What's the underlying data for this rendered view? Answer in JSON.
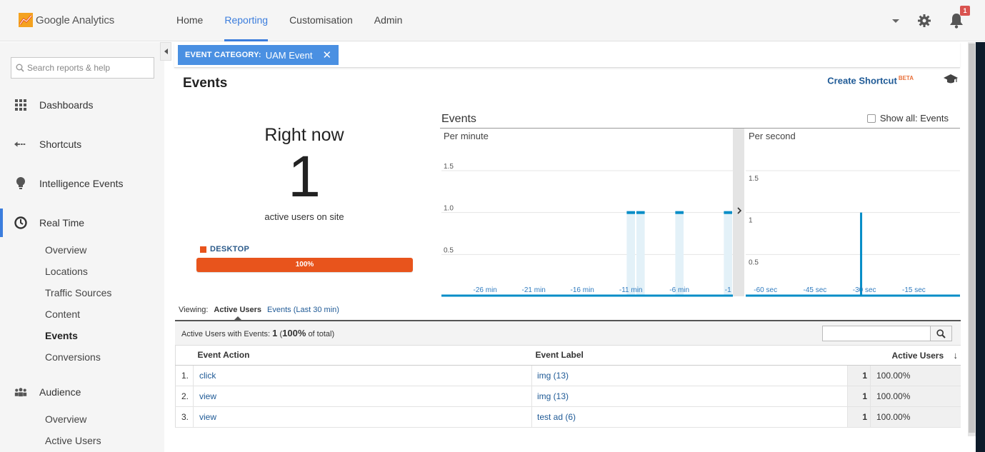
{
  "app": {
    "name": "Google Analytics"
  },
  "nav": {
    "items": [
      {
        "label": "Home",
        "active": false
      },
      {
        "label": "Reporting",
        "active": true
      },
      {
        "label": "Customisation",
        "active": false
      },
      {
        "label": "Admin",
        "active": false
      }
    ],
    "notification_count": "1"
  },
  "sidebar": {
    "search_placeholder": "Search reports & help",
    "sections": [
      {
        "label": "Dashboards",
        "icon": "grid-icon"
      },
      {
        "label": "Shortcuts",
        "icon": "shortcut-arrow-icon"
      },
      {
        "label": "Intelligence Events",
        "icon": "lightbulb-icon"
      },
      {
        "label": "Real Time",
        "icon": "clock-icon",
        "active": true
      },
      {
        "label": "Audience",
        "icon": "people-icon"
      }
    ],
    "realtime_items": [
      "Overview",
      "Locations",
      "Traffic Sources",
      "Content",
      "Events",
      "Conversions"
    ],
    "audience_items": [
      "Overview",
      "Active Users"
    ]
  },
  "filter": {
    "key": "EVENT CATEGORY:",
    "value": "UAM Event"
  },
  "page": {
    "title": "Events",
    "shortcut_label": "Create Shortcut",
    "shortcut_badge": "BETA"
  },
  "rightnow": {
    "title": "Right now",
    "count": "1",
    "subtitle": "active users on site",
    "device_label": "DESKTOP",
    "device_pct": "100%",
    "device_fraction": 1.0
  },
  "chart": {
    "title": "Events",
    "show_all_label": "Show all: Events",
    "show_all_checked": false,
    "accent": "#058dc7"
  },
  "chart_data": [
    {
      "type": "bar",
      "subtitle": "Per minute",
      "y_ticks": [
        "1.5",
        "1.0",
        "0.5"
      ],
      "ylim": [
        0,
        1.5
      ],
      "x_ticks": [
        "-26 min",
        "-21 min",
        "-16 min",
        "-11 min",
        "-6 min",
        "-1"
      ],
      "x_tick_minutes": [
        -26,
        -21,
        -16,
        -11,
        -6,
        -1
      ],
      "x": [
        -30,
        -29,
        -28,
        -27,
        -26,
        -25,
        -24,
        -23,
        -22,
        -21,
        -20,
        -19,
        -18,
        -17,
        -16,
        -15,
        -14,
        -13,
        -12,
        -11,
        -10,
        -9,
        -8,
        -7,
        -6,
        -5,
        -4,
        -3,
        -2,
        -1
      ],
      "values": [
        0,
        0,
        0,
        0,
        0,
        0,
        0,
        0,
        0,
        0,
        0,
        0,
        0,
        0,
        0,
        0,
        0,
        0,
        0,
        1,
        1,
        0,
        0,
        0,
        1,
        0,
        0,
        0,
        0,
        1
      ],
      "last_tick_suffix": "..."
    },
    {
      "type": "bar",
      "subtitle": "Per second",
      "y_ticks": [
        "1.5",
        "1",
        "0.5"
      ],
      "ylim": [
        0,
        1.5
      ],
      "x_ticks": [
        "-60 sec",
        "-45 sec",
        "-30 sec",
        "-15 sec"
      ],
      "x_tick_seconds": [
        -60,
        -45,
        -30,
        -15
      ],
      "xlim": [
        -66,
        -1
      ],
      "spikes": [
        {
          "x": -31,
          "value": 1
        }
      ]
    }
  ],
  "viewing": {
    "label": "Viewing:",
    "current": "Active Users",
    "other": "Events (Last 30 min)"
  },
  "summary": {
    "prefix": "Active Users with Events:",
    "count": "1",
    "pct": "100%",
    "suffix": "of total)",
    "open": "("
  },
  "table": {
    "columns": [
      "Event Action",
      "Event Label",
      "Active Users"
    ],
    "rows": [
      {
        "idx": "1.",
        "action": "click",
        "label": "img (13)",
        "users": "1",
        "pct": "100.00%"
      },
      {
        "idx": "2.",
        "action": "view",
        "label": "img (13)",
        "users": "1",
        "pct": "100.00%"
      },
      {
        "idx": "3.",
        "action": "view",
        "label": "test ad (6)",
        "users": "1",
        "pct": "100.00%"
      }
    ]
  }
}
